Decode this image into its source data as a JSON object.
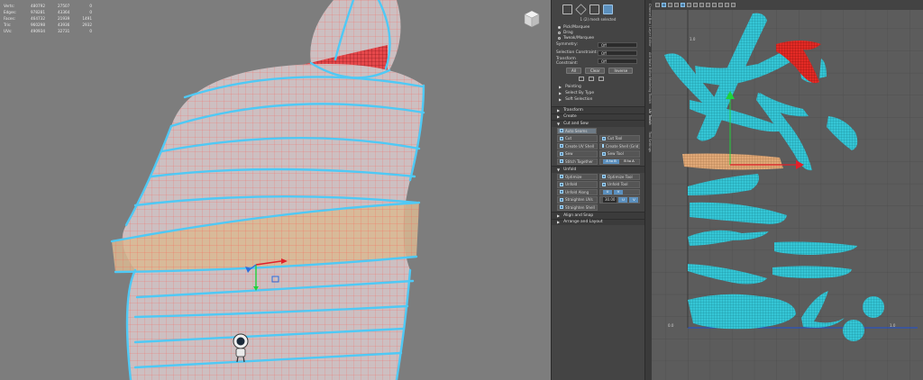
{
  "hud": {
    "rows": [
      {
        "label": "Verts:",
        "v1": "480792",
        "v2": "27507",
        "v3": "0"
      },
      {
        "label": "Edges:",
        "v1": "978281",
        "v2": "43364",
        "v3": "0"
      },
      {
        "label": "Faces:",
        "v1": "464732",
        "v2": "21939",
        "v3": "1491"
      },
      {
        "label": "Tris:",
        "v1": "960298",
        "v2": "43936",
        "v3": "2932"
      },
      {
        "label": "UVs:",
        "v1": "490934",
        "v2": "32731",
        "v3": "0"
      }
    ]
  },
  "colors": {
    "viewport_bg": "#7d7d7d",
    "mesh_fill": "#cdbfc1",
    "wire": "#ff5a4f",
    "seam": "#4fc9f5",
    "highlight_band": "#d9b892",
    "selected_faces": "#d8262b",
    "uv_bg": "#5c5c5c",
    "uv_shell": "#35c6d6",
    "uv_selected": "#e42a25",
    "uv_band": "#e0a877",
    "axis_x": "#e3202a",
    "axis_y": "#1fd33a",
    "axis_z": "#2b6dde"
  },
  "toolkit": {
    "status": "1 (2) mesh selected",
    "radio": [
      "Pick/Marquee",
      "Drag",
      "Tweak/Marquee"
    ],
    "symmetry_label": "Symmetry:",
    "symmetry_value": "Off",
    "selection_constraints_label": "Selection Constraint:",
    "selection_constraints_value": "Off",
    "transform_constraints_label": "Transform Constraint:",
    "transform_constraints_value": "Off",
    "buttons": [
      "All",
      "Clear",
      "Inverse"
    ],
    "subsections": [
      "Painting",
      "Select By Type",
      "Soft Selection"
    ],
    "sections": {
      "transform": "Transform",
      "create": "Create",
      "cut_sew": "Cut and Sew",
      "unfold": "Unfold",
      "align": "Align and Snap",
      "arrange": "Arrange and Layout"
    },
    "cut_tools": {
      "auto_seams": "Auto Seams",
      "cut": "Cut",
      "cut_tool": "Cut Tool",
      "create_uv_shell": "Create UV Shell",
      "create_shell_grid": "Create Shell (Grid)",
      "sew": "Sew",
      "sew_tool": "Sew Tool",
      "stitch_together": "Stitch Together",
      "a_to_b": "A to B",
      "b_to_a": "B to A"
    },
    "unfold_tools": {
      "optimize": "Optimize",
      "optimize_tool": "Optimize Tool",
      "unfold": "Unfold",
      "unfold_tool": "Unfold Tool",
      "unfold_along": "Unfold Along",
      "u": "U",
      "v": "V",
      "straighten_uvs": "Straighten UVs",
      "angle": "30.00",
      "straighten_shell": "Straighten Shell"
    }
  },
  "vertical_tabs": [
    "Channel Box / Layer Editor",
    "Attribute Editor",
    "Modeling Toolkit",
    "UV Toolkit",
    "Tool Settings"
  ],
  "uv_axis_labels": [
    "0.0",
    "1.0"
  ],
  "uv_toolbar_icon_count": 13
}
